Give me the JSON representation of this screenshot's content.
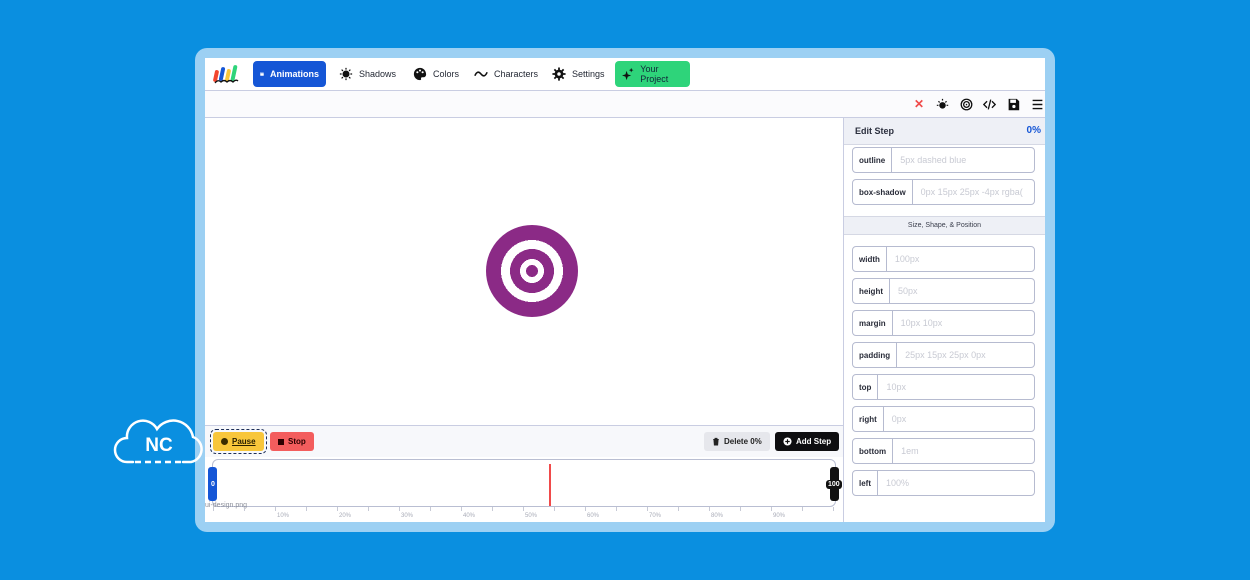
{
  "nav": {
    "items": [
      {
        "label": "Animations",
        "icon": "clapperboard-icon"
      },
      {
        "label": "Shadows",
        "icon": "sun-shadow-icon"
      },
      {
        "label": "Colors",
        "icon": "palette-icon"
      },
      {
        "label": "Characters",
        "icon": "tilde-icon"
      },
      {
        "label": "Settings",
        "icon": "gear-icon"
      },
      {
        "label": "Your Project",
        "icon": "sparkle-icon"
      }
    ]
  },
  "toolbar": {
    "icons": [
      "close-icon",
      "theme-icon",
      "target-icon",
      "code-icon",
      "save-icon",
      "menu-icon"
    ]
  },
  "controls": {
    "pause_label": "Pause",
    "stop_label": "Stop",
    "delete_label": "Delete 0%",
    "add_label": "Add Step"
  },
  "timeline": {
    "start_label": "0",
    "end_label": "100",
    "file_label": "ui-design.png",
    "tick_labels": [
      "10%",
      "20%",
      "30%",
      "40%",
      "50%",
      "60%",
      "70%",
      "80%",
      "90%"
    ],
    "playhead_percent": 54
  },
  "panel": {
    "title": "Edit Step",
    "percent": "0%",
    "section_title": "Size, Shape, & Position",
    "fields_top": [
      {
        "label": "outline",
        "placeholder": "5px dashed blue"
      },
      {
        "label": "box-shadow",
        "placeholder": "0px 15px 25px -4px rgba("
      }
    ],
    "fields_size": [
      {
        "label": "width",
        "placeholder": "100px"
      },
      {
        "label": "height",
        "placeholder": "50px"
      },
      {
        "label": "margin",
        "placeholder": "10px 10px"
      },
      {
        "label": "padding",
        "placeholder": "25px 15px 25px 0px"
      },
      {
        "label": "top",
        "placeholder": "10px"
      },
      {
        "label": "right",
        "placeholder": "0px"
      },
      {
        "label": "bottom",
        "placeholder": "1em"
      },
      {
        "label": "left",
        "placeholder": "100%"
      }
    ]
  },
  "brand": {
    "badge_text": "NC"
  },
  "colors": {
    "background": "#0a8fe0",
    "active_nav": "#1556d6",
    "project_nav": "#2ed47a",
    "target": "#8b2a86",
    "pause": "#f8c63b",
    "stop": "#f35d5d",
    "playhead": "#f04a4a"
  }
}
